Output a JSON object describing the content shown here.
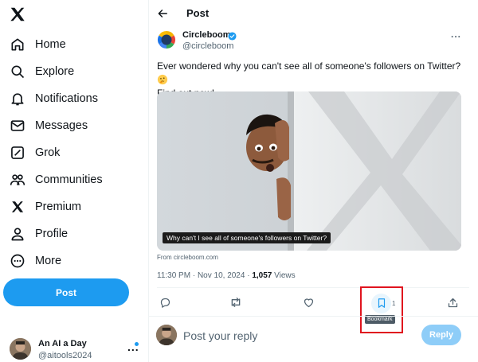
{
  "sidebar": {
    "logo": "x-logo-icon",
    "items": [
      {
        "label": "Home",
        "icon": "home-icon"
      },
      {
        "label": "Explore",
        "icon": "search-icon"
      },
      {
        "label": "Notifications",
        "icon": "bell-icon"
      },
      {
        "label": "Messages",
        "icon": "envelope-icon"
      },
      {
        "label": "Grok",
        "icon": "grok-icon"
      },
      {
        "label": "Communities",
        "icon": "communities-icon"
      },
      {
        "label": "Premium",
        "icon": "x-logo-icon"
      },
      {
        "label": "Profile",
        "icon": "person-icon"
      },
      {
        "label": "More",
        "icon": "more-circle-icon"
      }
    ],
    "post_button": "Post",
    "account": {
      "name": "An AI a Day",
      "handle": "@aitools2024",
      "more": "..."
    }
  },
  "header": {
    "title": "Post"
  },
  "tweet": {
    "author_name": "Circleboom",
    "author_handle": "@circleboom",
    "more": "...",
    "text": "Ever wondered why you can't see all of someone's followers on Twitter?",
    "text_end": "Find out now!",
    "emoji": "thinking-face",
    "media_caption": "Why can't I see all of someone's followers on Twitter?",
    "from_label": "From circleboom.com",
    "time": "11:30 PM · Nov 10, 2024 · ",
    "views_count": "1,057",
    "views_label": " Views"
  },
  "actions": {
    "bookmark_count": "1",
    "bookmark_tooltip": "Bookmark"
  },
  "reply": {
    "placeholder": "Post your reply",
    "button": "Reply"
  },
  "colors": {
    "accent": "#1d9bf0",
    "reply_disabled": "#8ecdf8",
    "highlight_box": "#e0141e"
  }
}
